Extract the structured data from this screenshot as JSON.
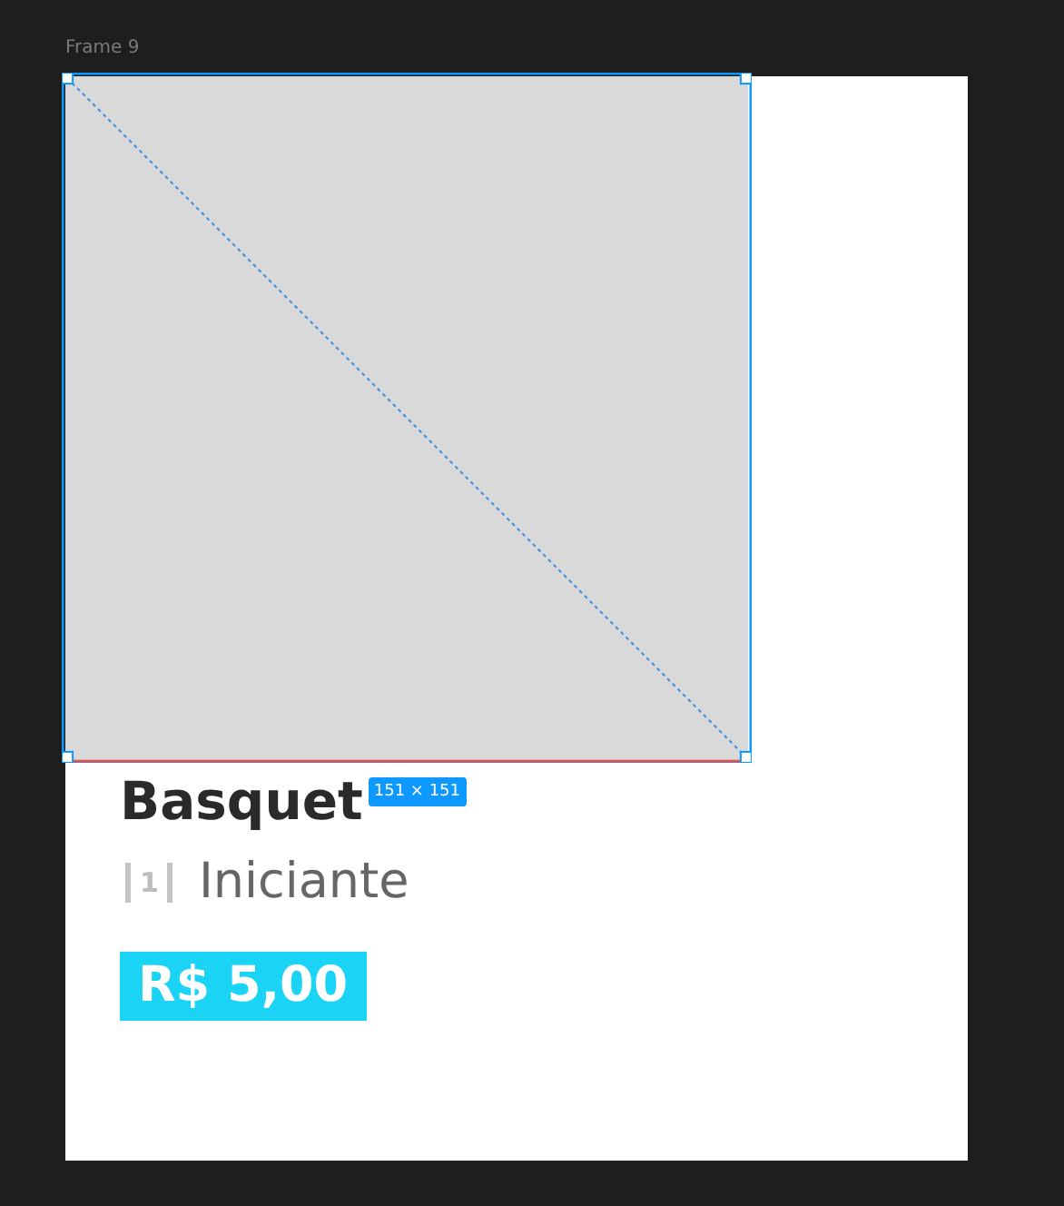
{
  "canvas": {
    "frame_label": "Frame 9"
  },
  "card": {
    "title": "Basquet",
    "level": {
      "number": "1",
      "label": "Iniciante"
    },
    "price": "R$ 5,00"
  },
  "selection": {
    "size_label": "151 × 151"
  }
}
